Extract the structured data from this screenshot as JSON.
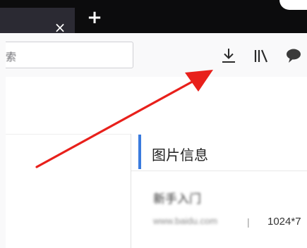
{
  "tabstrip": {
    "close_glyph": "×",
    "new_tab_glyph": "+"
  },
  "toolbar": {
    "search_placeholder_fragment": "索",
    "icons": [
      "download-icon",
      "library-icon",
      "speech-bubble-icon"
    ]
  },
  "panel": {
    "title": "图片信息",
    "item_name": "新手入门",
    "item_url": "www.baidu.com",
    "divider": "|",
    "item_size": "1024*7"
  },
  "annotation": {
    "arrow_color": "#e8201b"
  },
  "colors": {
    "tab_strip": "#0c0c0d",
    "active_tab": "#2b2a33",
    "panel_accent": "#3a7bde"
  }
}
